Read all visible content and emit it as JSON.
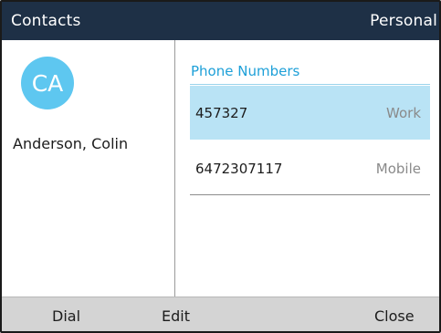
{
  "header": {
    "title": "Contacts",
    "directory": "Personal"
  },
  "contact": {
    "initials": "CA",
    "name": "Anderson, Colin"
  },
  "phone_section": {
    "label": "Phone Numbers",
    "entries": [
      {
        "number": "457327",
        "type": "Work",
        "selected": true
      },
      {
        "number": "6472307117",
        "type": "Mobile",
        "selected": false
      }
    ]
  },
  "softkeys": {
    "dial": "Dial",
    "edit": "Edit",
    "close": "Close"
  },
  "colors": {
    "header_bg": "#1e3046",
    "accent": "#1ea0d8",
    "avatar": "#5ec7f0",
    "selected_row": "#b9e3f5",
    "softkey_bar": "#d4d4d4"
  }
}
